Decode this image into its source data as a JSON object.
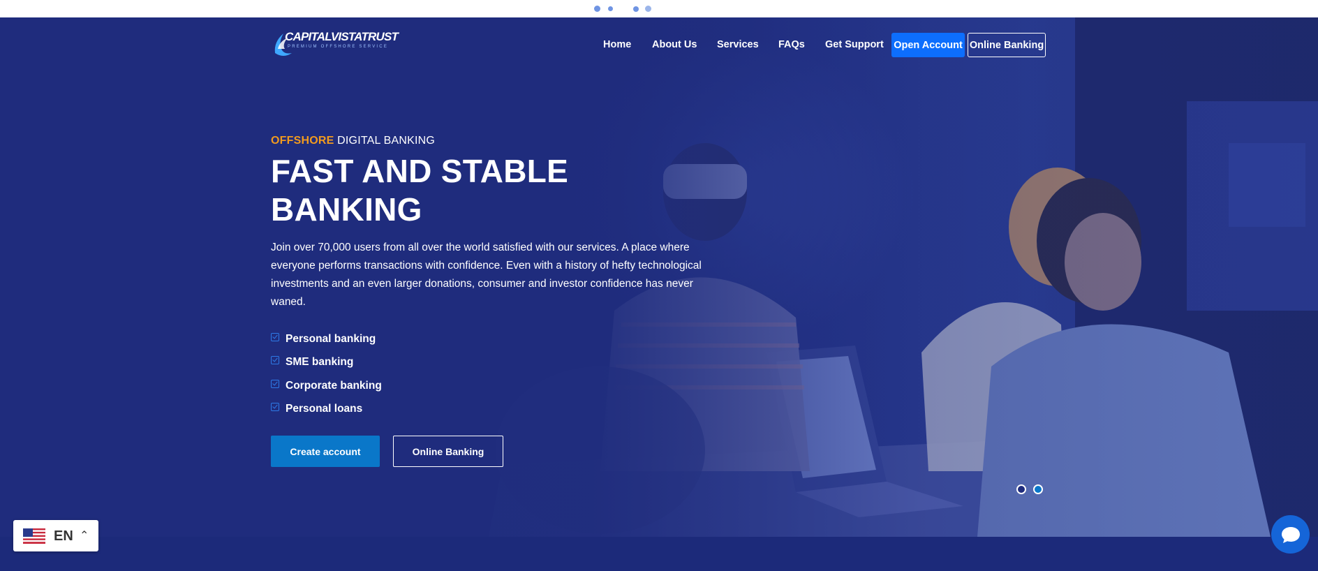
{
  "brand": {
    "name": "CAPITALVISTATRUST",
    "tagline": "PREMIUM OFFSHORE SERVICE"
  },
  "nav": {
    "items": [
      {
        "label": "Home"
      },
      {
        "label": "About Us"
      },
      {
        "label": "Services"
      },
      {
        "label": "FAQs"
      },
      {
        "label": "Get Support"
      }
    ],
    "open_account": "Open Account",
    "online_banking": "Online Banking"
  },
  "hero": {
    "eyebrow_accent": "OFFSHORE",
    "eyebrow_rest": " DIGITAL BANKING",
    "headline": "FAST AND STABLE BANKING",
    "lead": "Join over 70,000 users from all over the world satisfied with our services. A place where everyone performs transactions with confidence. Even with a history of hefty technological investments and an even larger donations, consumer and investor confidence has never waned.",
    "features": [
      "Personal banking",
      "SME banking",
      "Corporate banking",
      "Personal loans"
    ],
    "cta_primary": "Create account",
    "cta_secondary": "Online Banking",
    "slider": {
      "count": 2,
      "active": 2
    }
  },
  "language": {
    "code": "EN",
    "flag_icon": "us-flag-icon",
    "caret_icon": "chevron-up-icon"
  },
  "chat": {
    "icon": "chat-bubble-icon"
  },
  "colors": {
    "hero_bg": "#1f2c7d",
    "accent_orange": "#f29b1e",
    "primary_blue": "#0d6efd",
    "cta_blue": "#0a77c9",
    "chat_blue": "#1565d8"
  }
}
